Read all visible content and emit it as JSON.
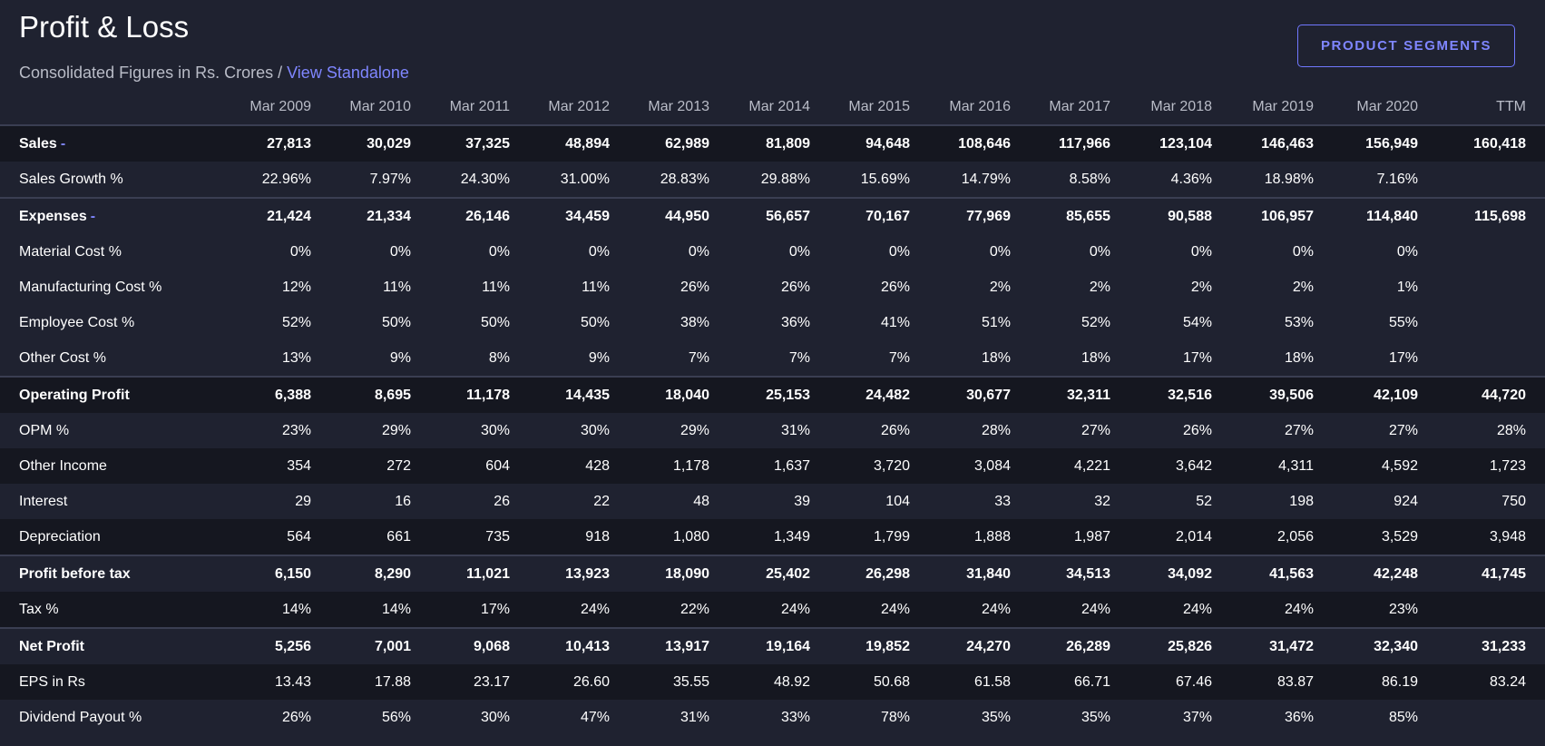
{
  "header": {
    "title": "Profit & Loss",
    "subtitle_prefix": "Consolidated Figures in Rs. Crores / ",
    "standalone_link": "View Standalone",
    "segments_button": "PRODUCT SEGMENTS"
  },
  "table": {
    "columns": [
      "Mar 2009",
      "Mar 2010",
      "Mar 2011",
      "Mar 2012",
      "Mar 2013",
      "Mar 2014",
      "Mar 2015",
      "Mar 2016",
      "Mar 2017",
      "Mar 2018",
      "Mar 2019",
      "Mar 2020",
      "TTM"
    ],
    "rows": [
      {
        "label": "Sales",
        "expand": "-",
        "strong": true,
        "sep": false,
        "shade": "a",
        "values": [
          "27,813",
          "30,029",
          "37,325",
          "48,894",
          "62,989",
          "81,809",
          "94,648",
          "108,646",
          "117,966",
          "123,104",
          "146,463",
          "156,949",
          "160,418"
        ]
      },
      {
        "label": "Sales Growth %",
        "expand": "",
        "strong": false,
        "sep": false,
        "shade": "b",
        "values": [
          "22.96%",
          "7.97%",
          "24.30%",
          "31.00%",
          "28.83%",
          "29.88%",
          "15.69%",
          "14.79%",
          "8.58%",
          "4.36%",
          "18.98%",
          "7.16%",
          ""
        ]
      },
      {
        "label": "Expenses",
        "expand": "-",
        "strong": true,
        "sep": true,
        "shade": "b",
        "values": [
          "21,424",
          "21,334",
          "26,146",
          "34,459",
          "44,950",
          "56,657",
          "70,167",
          "77,969",
          "85,655",
          "90,588",
          "106,957",
          "114,840",
          "115,698"
        ]
      },
      {
        "label": "Material Cost %",
        "expand": "",
        "strong": false,
        "sep": false,
        "shade": "b",
        "values": [
          "0%",
          "0%",
          "0%",
          "0%",
          "0%",
          "0%",
          "0%",
          "0%",
          "0%",
          "0%",
          "0%",
          "0%",
          ""
        ]
      },
      {
        "label": "Manufacturing Cost %",
        "expand": "",
        "strong": false,
        "sep": false,
        "shade": "b",
        "values": [
          "12%",
          "11%",
          "11%",
          "11%",
          "26%",
          "26%",
          "26%",
          "2%",
          "2%",
          "2%",
          "2%",
          "1%",
          ""
        ]
      },
      {
        "label": "Employee Cost %",
        "expand": "",
        "strong": false,
        "sep": false,
        "shade": "b",
        "values": [
          "52%",
          "50%",
          "50%",
          "50%",
          "38%",
          "36%",
          "41%",
          "51%",
          "52%",
          "54%",
          "53%",
          "55%",
          ""
        ]
      },
      {
        "label": "Other Cost %",
        "expand": "",
        "strong": false,
        "sep": false,
        "shade": "b",
        "values": [
          "13%",
          "9%",
          "8%",
          "9%",
          "7%",
          "7%",
          "7%",
          "18%",
          "18%",
          "17%",
          "18%",
          "17%",
          ""
        ]
      },
      {
        "label": "Operating Profit",
        "expand": "",
        "strong": true,
        "sep": true,
        "shade": "a",
        "values": [
          "6,388",
          "8,695",
          "11,178",
          "14,435",
          "18,040",
          "25,153",
          "24,482",
          "30,677",
          "32,311",
          "32,516",
          "39,506",
          "42,109",
          "44,720"
        ]
      },
      {
        "label": "OPM %",
        "expand": "",
        "strong": false,
        "sep": false,
        "shade": "b",
        "values": [
          "23%",
          "29%",
          "30%",
          "30%",
          "29%",
          "31%",
          "26%",
          "28%",
          "27%",
          "26%",
          "27%",
          "27%",
          "28%"
        ]
      },
      {
        "label": "Other Income",
        "expand": "",
        "strong": false,
        "sep": false,
        "shade": "a",
        "values": [
          "354",
          "272",
          "604",
          "428",
          "1,178",
          "1,637",
          "3,720",
          "3,084",
          "4,221",
          "3,642",
          "4,311",
          "4,592",
          "1,723"
        ]
      },
      {
        "label": "Interest",
        "expand": "",
        "strong": false,
        "sep": false,
        "shade": "b",
        "values": [
          "29",
          "16",
          "26",
          "22",
          "48",
          "39",
          "104",
          "33",
          "32",
          "52",
          "198",
          "924",
          "750"
        ]
      },
      {
        "label": "Depreciation",
        "expand": "",
        "strong": false,
        "sep": false,
        "shade": "a",
        "values": [
          "564",
          "661",
          "735",
          "918",
          "1,080",
          "1,349",
          "1,799",
          "1,888",
          "1,987",
          "2,014",
          "2,056",
          "3,529",
          "3,948"
        ]
      },
      {
        "label": "Profit before tax",
        "expand": "",
        "strong": true,
        "sep": true,
        "shade": "b",
        "values": [
          "6,150",
          "8,290",
          "11,021",
          "13,923",
          "18,090",
          "25,402",
          "26,298",
          "31,840",
          "34,513",
          "34,092",
          "41,563",
          "42,248",
          "41,745"
        ]
      },
      {
        "label": "Tax %",
        "expand": "",
        "strong": false,
        "sep": false,
        "shade": "a",
        "values": [
          "14%",
          "14%",
          "17%",
          "24%",
          "22%",
          "24%",
          "24%",
          "24%",
          "24%",
          "24%",
          "24%",
          "23%",
          ""
        ]
      },
      {
        "label": "Net Profit",
        "expand": "",
        "strong": true,
        "sep": true,
        "shade": "b",
        "values": [
          "5,256",
          "7,001",
          "9,068",
          "10,413",
          "13,917",
          "19,164",
          "19,852",
          "24,270",
          "26,289",
          "25,826",
          "31,472",
          "32,340",
          "31,233"
        ]
      },
      {
        "label": "EPS in Rs",
        "expand": "",
        "strong": false,
        "sep": false,
        "shade": "a",
        "values": [
          "13.43",
          "17.88",
          "23.17",
          "26.60",
          "35.55",
          "48.92",
          "50.68",
          "61.58",
          "66.71",
          "67.46",
          "83.87",
          "86.19",
          "83.24"
        ]
      },
      {
        "label": "Dividend Payout %",
        "expand": "",
        "strong": false,
        "sep": false,
        "shade": "b",
        "values": [
          "26%",
          "56%",
          "30%",
          "47%",
          "31%",
          "33%",
          "78%",
          "35%",
          "35%",
          "37%",
          "36%",
          "85%",
          ""
        ]
      }
    ]
  }
}
